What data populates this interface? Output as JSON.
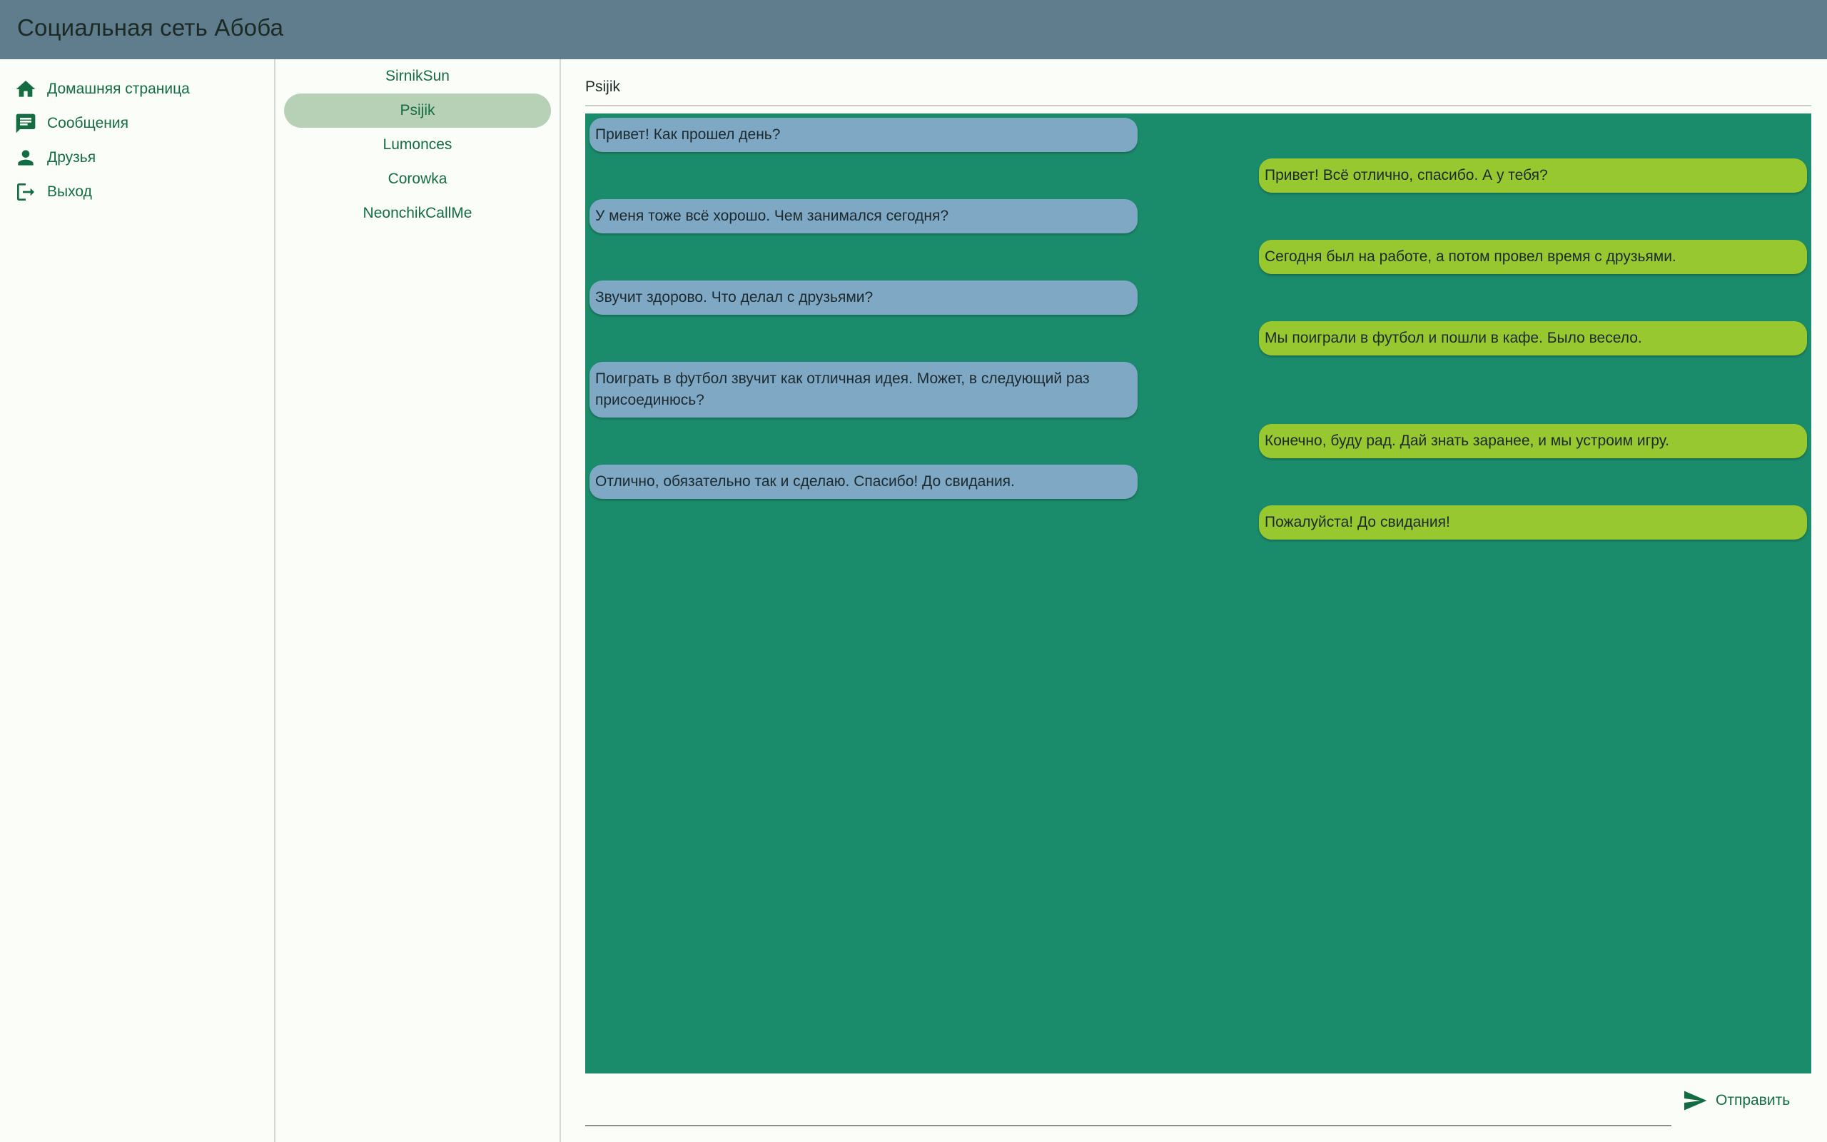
{
  "app": {
    "title": "Социальная сеть Абоба"
  },
  "nav": {
    "items": [
      {
        "label": "Домашняя страница",
        "icon": "home-icon"
      },
      {
        "label": "Сообщения",
        "icon": "chat-icon"
      },
      {
        "label": "Друзья",
        "icon": "person-icon"
      },
      {
        "label": "Выход",
        "icon": "logout-icon"
      }
    ]
  },
  "conversations": {
    "items": [
      {
        "name": "SirnikSun"
      },
      {
        "name": "Psijik",
        "active": true
      },
      {
        "name": "Lumonces"
      },
      {
        "name": "Corowka"
      },
      {
        "name": "NeonchikCallMe"
      }
    ]
  },
  "chat": {
    "contact_name": "Psijik",
    "messages": [
      {
        "from": "them",
        "text": "Привет! Как прошел день?"
      },
      {
        "from": "me",
        "text": "Привет! Всё отлично, спасибо. А у тебя?"
      },
      {
        "from": "them",
        "text": "У меня тоже всё хорошо. Чем занимался сегодня?"
      },
      {
        "from": "me",
        "text": "Сегодня был на работе, а потом провел время с друзьями."
      },
      {
        "from": "them",
        "text": "Звучит здорово. Что делал с друзьями?"
      },
      {
        "from": "me",
        "text": "Мы поиграли в футбол и пошли в кафе. Было весело."
      },
      {
        "from": "them",
        "text": "Поиграть в футбол звучит как отличная идея. Может, в следующий раз присоединюсь?"
      },
      {
        "from": "me",
        "text": "Конечно, буду рад. Дай знать заранее, и мы устроим игру."
      },
      {
        "from": "them",
        "text": "Отлично, обязательно так и сделаю. Спасибо! До свидания."
      },
      {
        "from": "me",
        "text": "Пожалуйста! До свидания!"
      }
    ]
  },
  "composer": {
    "value": "",
    "placeholder": "",
    "send_label": "Отправить",
    "send_icon": "send-icon"
  },
  "colors": {
    "appbar": "#5f7d8c",
    "accent": "#146c43",
    "chat_background": "#1b8c6b",
    "incoming_bubble": "#7ea8c4",
    "outgoing_bubble": "#97c830",
    "active_conversation": "#b7d1b7"
  }
}
